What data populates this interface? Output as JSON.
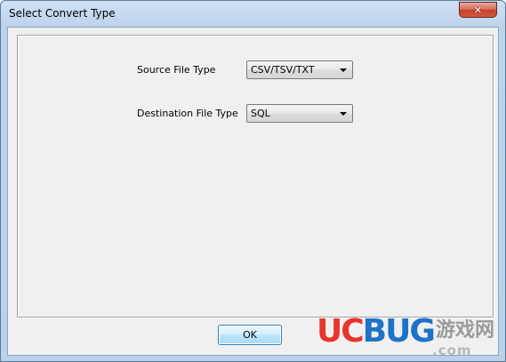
{
  "window": {
    "title": "Select Convert Type"
  },
  "titlebar": {
    "close_glyph": "✕"
  },
  "form": {
    "source": {
      "label": "Source File Type",
      "selected": "CSV/TSV/TXT"
    },
    "destination": {
      "label": "Destination File Type",
      "selected": "SQL"
    }
  },
  "buttons": {
    "ok_label": "OK"
  },
  "watermark": {
    "brand_uc": "UC",
    "brand_bug": "BUG",
    "cn_text": "游戏网",
    "domain": ".com"
  },
  "colors": {
    "titlebar": "#b9d1ea",
    "client_bg": "#f0f0f0",
    "close_button": "#c4402a",
    "ok_border": "#3c7fb1",
    "watermark_red": "#e8342c",
    "watermark_blue": "#1e73c8"
  },
  "icons": {
    "close": "close-icon",
    "dropdown": "chevron-down-icon"
  }
}
